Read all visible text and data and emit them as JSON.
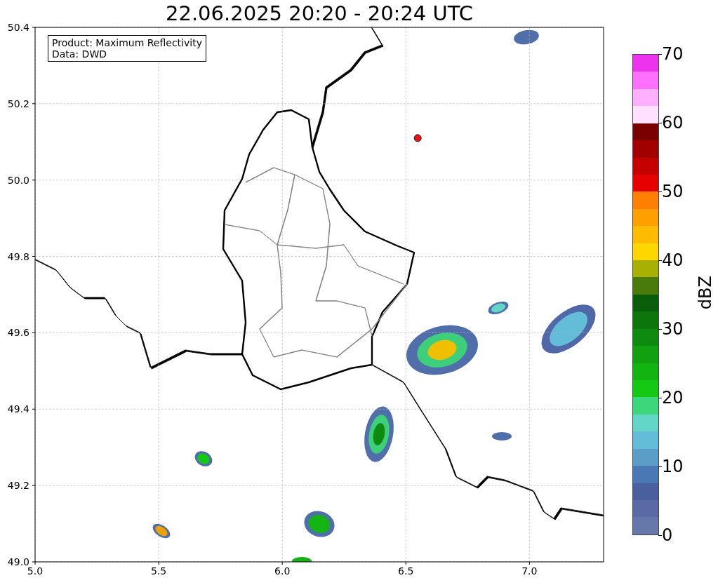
{
  "plot": {
    "legend": {
      "lines": [
        "Product: Maximum Reflectivity",
        "Data: DWD"
      ]
    },
    "chart_data": {
      "type": "scatter",
      "title": "22.06.2025 20:20 - 20:24 UTC",
      "grid": true,
      "xlim": [
        5.0,
        7.3
      ],
      "ylim": [
        49.0,
        50.4
      ],
      "xticks": [
        {
          "value": 5.0,
          "label": "5.0"
        },
        {
          "value": 5.5,
          "label": "5.5"
        },
        {
          "value": 6.0,
          "label": "6.0"
        },
        {
          "value": 6.5,
          "label": "6.5"
        },
        {
          "value": 7.0,
          "label": "7.0"
        }
      ],
      "yticks": [
        {
          "value": 49.0,
          "label": "49.0"
        },
        {
          "value": 49.2,
          "label": "49.2"
        },
        {
          "value": 49.4,
          "label": "49.4"
        },
        {
          "value": 49.6,
          "label": "49.6"
        },
        {
          "value": 49.8,
          "label": "49.8"
        },
        {
          "value": 50.0,
          "label": "50.0"
        },
        {
          "value": 50.2,
          "label": "50.2"
        },
        {
          "value": 50.4,
          "label": "50.4"
        }
      ],
      "x": [
        6.548
      ],
      "series": [
        {
          "color": "#e8141c",
          "values": [
            50.11
          ]
        }
      ]
    }
  },
  "colorbar": {
    "label": "dBZ",
    "ticks": [
      "70",
      "60",
      "50",
      "40",
      "30",
      "20",
      "10",
      "0"
    ],
    "bins": [
      {
        "color": "#ee33ee"
      },
      {
        "color": "#ff70ff"
      },
      {
        "color": "#ffb0ff"
      },
      {
        "color": "#ffe0ff"
      },
      {
        "color": "#7a0000"
      },
      {
        "color": "#a00000"
      },
      {
        "color": "#c40000"
      },
      {
        "color": "#e60000"
      },
      {
        "color": "#ff7f00"
      },
      {
        "color": "#ff9f00"
      },
      {
        "color": "#ffbb00"
      },
      {
        "color": "#ffd700"
      },
      {
        "color": "#a8b000"
      },
      {
        "color": "#4a7a0a"
      },
      {
        "color": "#0a5e0a"
      },
      {
        "color": "#0c760c"
      },
      {
        "color": "#0e8a0e"
      },
      {
        "color": "#10a010"
      },
      {
        "color": "#12b412"
      },
      {
        "color": "#14c814"
      },
      {
        "color": "#3ed67a"
      },
      {
        "color": "#63d6c8"
      },
      {
        "color": "#63bcd8"
      },
      {
        "color": "#5a9ec8"
      },
      {
        "color": "#4a78b4"
      },
      {
        "color": "#4a5f9e"
      },
      {
        "color": "#5a6aa4"
      },
      {
        "color": "#6677aa"
      }
    ]
  }
}
